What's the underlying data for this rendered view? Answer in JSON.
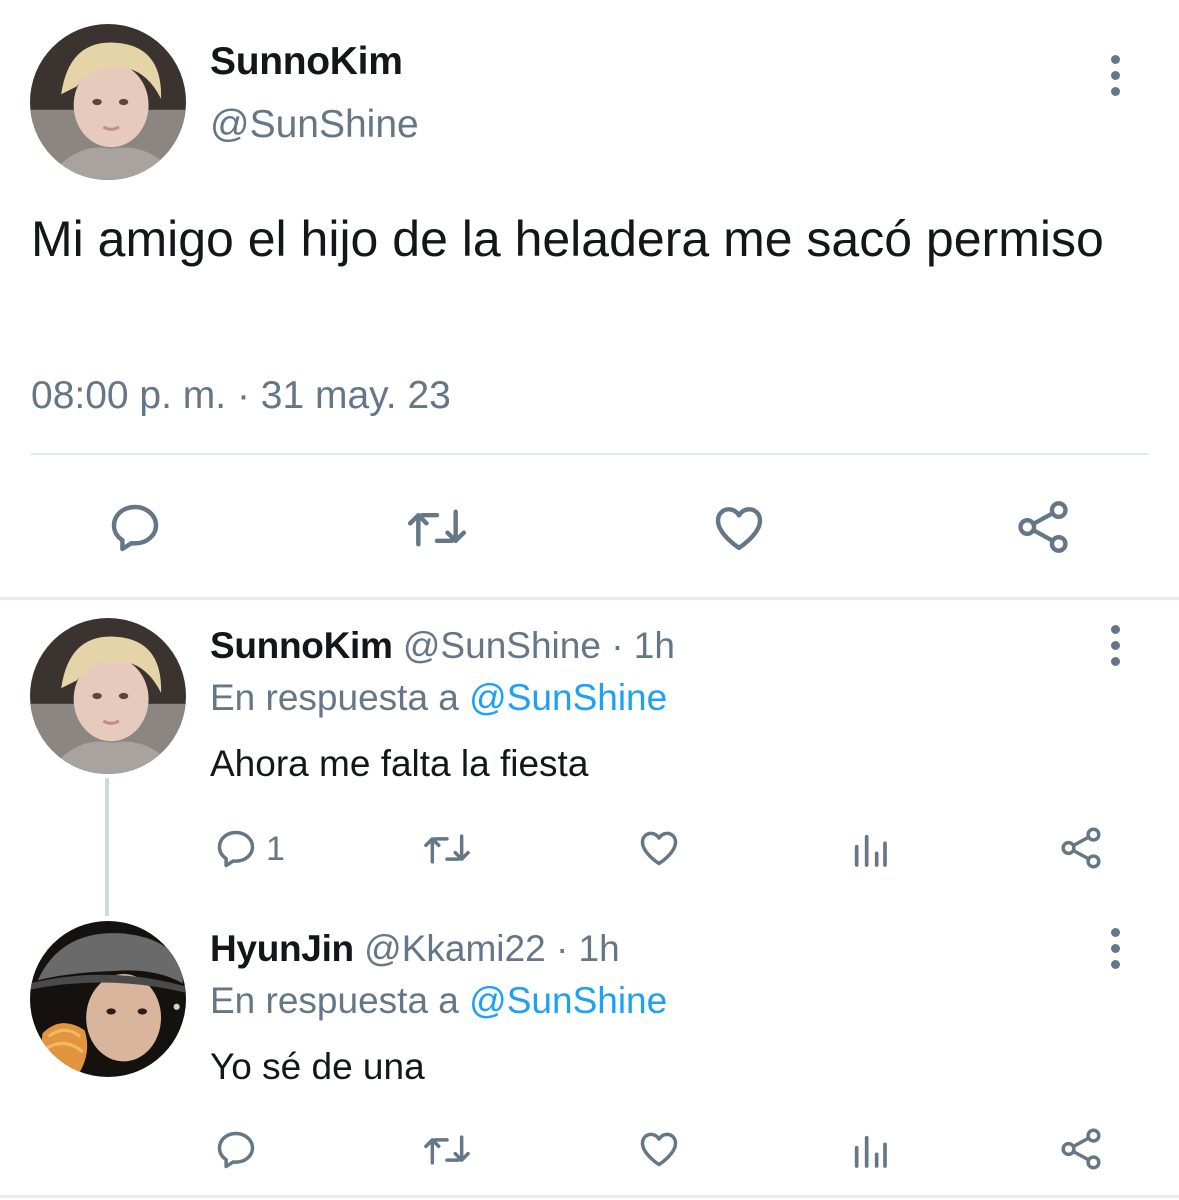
{
  "tweet": {
    "author_name": "SunnoKim",
    "author_handle": "@SunShine",
    "text": "Mi amigo el hijo de la heladera me sacó permiso",
    "timestamp": "08:00 p. m. · 31 may. 23",
    "actions": [
      "reply-icon",
      "retweet-icon",
      "like-icon",
      "share-icon"
    ]
  },
  "replies": [
    {
      "author_name": "SunnoKim",
      "author_handle": "@SunShine",
      "time": "· 1h",
      "reply_prefix": "En respuesta a",
      "reply_mention": "@SunShine",
      "text": "Ahora me falta la fiesta",
      "reply_count": "1"
    },
    {
      "author_name": "HyunJin",
      "author_handle": "@Kkami22",
      "time": "· 1h",
      "reply_prefix": "En respuesta a",
      "reply_mention": "@SunShine",
      "text": "Yo sé de una",
      "reply_count": ""
    }
  ],
  "colors": {
    "text": "#14171a",
    "secondary": "#657786",
    "link": "#1da1f2",
    "divider": "#e1e8ed"
  }
}
